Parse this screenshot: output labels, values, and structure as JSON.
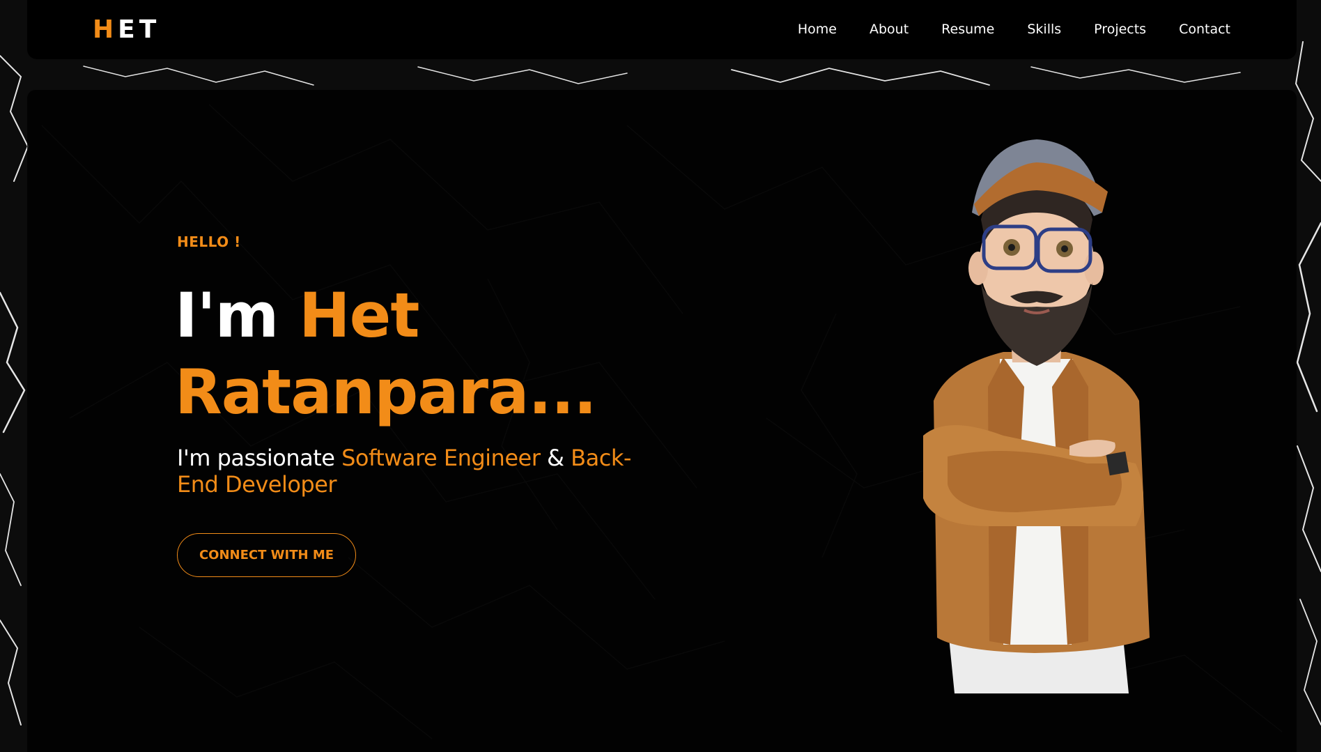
{
  "logo": {
    "first": "H",
    "rest": "ET"
  },
  "nav": [
    "Home",
    "About",
    "Resume",
    "Skills",
    "Projects",
    "Contact"
  ],
  "hero": {
    "greeting": "HELLO !",
    "im": "I'm",
    "first_name": "Het",
    "last_name": "Ratanpara...",
    "passion_prefix": "I'm passionate",
    "role1": "Software Engineer",
    "amp": "&",
    "role2": "Back-End Developer",
    "cta": "CONNECT WITH ME"
  },
  "colors": {
    "accent": "#f28c18",
    "background": "#000000",
    "text": "#ffffff"
  },
  "icons": {
    "avatar": "avatar-3d-character-icon"
  }
}
